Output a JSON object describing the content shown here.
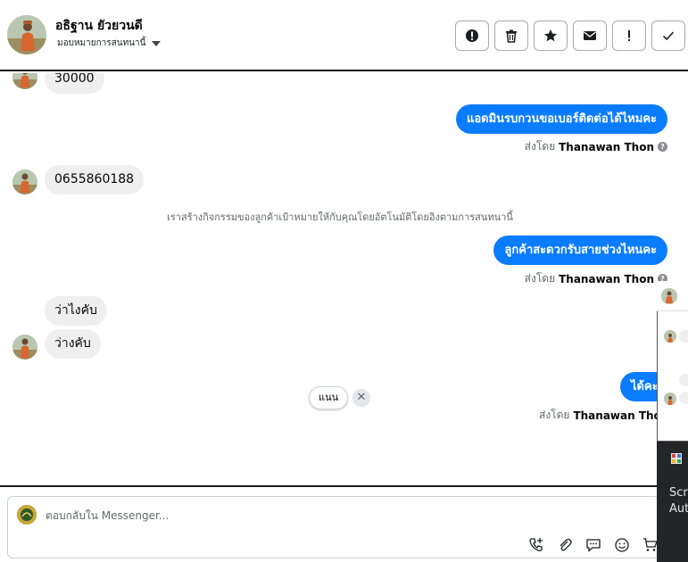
{
  "header": {
    "contact_name": "อธิฐาน ยัวยวนดี",
    "assign_label": "มอบหมายการสนทนานี้",
    "buttons": [
      {
        "name": "alert-icon"
      },
      {
        "name": "trash-icon"
      },
      {
        "name": "star-icon"
      },
      {
        "name": "mail-icon"
      },
      {
        "name": "exclamation-icon"
      },
      {
        "name": "check-icon"
      }
    ]
  },
  "messages": {
    "m1": "30000",
    "m2_out": "แอดมินรบกวนขอเบอร์ติดต่อได้ไหมคะ",
    "m3": "0655860188",
    "m4_out": "ลูกค้าสะดวกรับสายช่วงไหนคะ",
    "m5": "ว่าไงคับ",
    "m6": "ว่างคับ",
    "m7_out": "ได้คะ"
  },
  "sent_by": {
    "prefix": "ส่งโดย",
    "author": "Thanawan Thon",
    "help": "?"
  },
  "system_note": "เราสร้างกิจกรรมของลูกค้าเป้าหมายให้กับคุณโดยอัตโนมัติโดยอิงตามการสนทนานี้",
  "suggestion": {
    "chip_label": "แนน",
    "dismiss": "✕"
  },
  "composer": {
    "placeholder": "ตอบกลับใน Messenger...",
    "tools": [
      "phone-add-icon",
      "attach-icon",
      "chat-bubble-icon",
      "emoji-icon",
      "cart-icon"
    ]
  },
  "side_panel": {
    "line1": "Scr",
    "line2": "Aut"
  },
  "colors": {
    "accent": "#0a7cff",
    "incoming_bubble": "#efefef",
    "muted_text": "#65676b"
  }
}
